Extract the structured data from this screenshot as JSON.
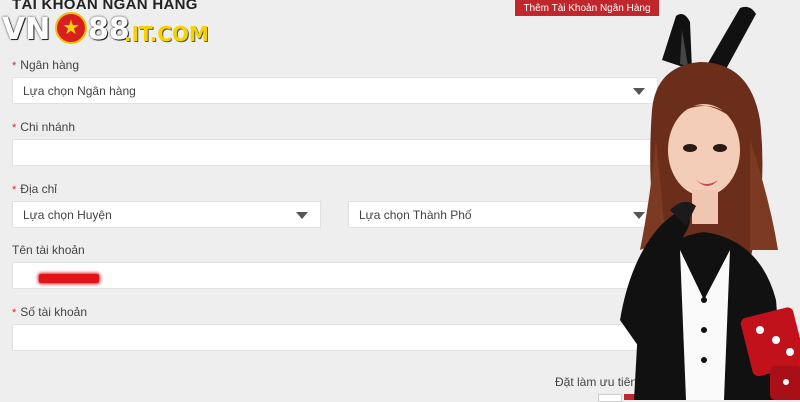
{
  "header": {
    "title": "TÀI KHOẢN NGÂN HÀNG",
    "add_button": "Thêm Tài Khoản Ngân Hàng"
  },
  "logo": {
    "part1": "VN",
    "part2": "88",
    "domain": ".IT.COM",
    "star_icon": "★"
  },
  "form": {
    "required_mark": "*",
    "bank": {
      "label": "Ngân hàng",
      "value": "Lựa chọn Ngân hàng"
    },
    "branch": {
      "label": "Chi nhánh",
      "value": ""
    },
    "address": {
      "label": "Địa chỉ",
      "district": "Lựa chọn Huyện",
      "city": "Lựa chọn Thành Phố"
    },
    "account_name": {
      "label": "Tên tài khoản"
    },
    "account_number": {
      "label": "Số tài khoản",
      "value": ""
    },
    "priority": {
      "label": "Đặt làm ưu tiên",
      "checked": false
    }
  },
  "colors": {
    "accent": "#c0272d",
    "background": "#eeeeee",
    "logo_yellow": "#f6d200"
  }
}
